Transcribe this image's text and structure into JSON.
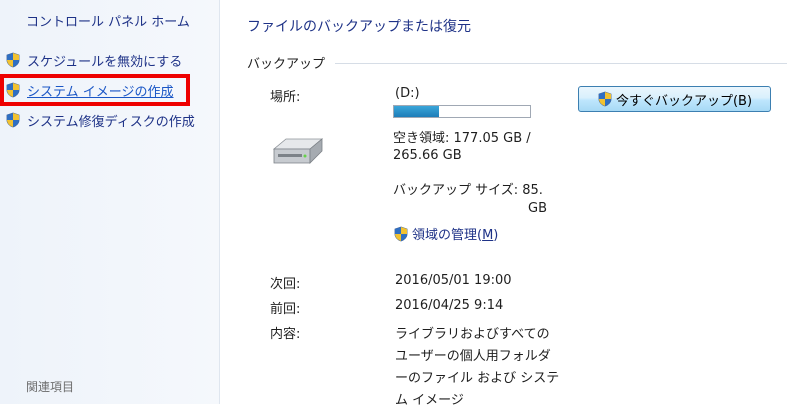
{
  "sidebar": {
    "home": "コントロール パネル ホーム",
    "items": [
      {
        "label": "スケジュールを無効にする"
      },
      {
        "label": "システム イメージの作成"
      },
      {
        "label": "システム修復ディスクの作成"
      }
    ],
    "related": "関連項目"
  },
  "main": {
    "title": "ファイルのバックアップまたは復元",
    "section_label": "バックアップ",
    "location_label": "場所:",
    "drive": "(D:)",
    "usage_fraction": 0.33,
    "free_line1": "空き領域: 177.05 GB /",
    "free_line2": "265.66 GB",
    "backup_size_line1": "バックアップ サイズ: 85.",
    "backup_size_line2": "GB",
    "manage_link": "領域の管理(",
    "manage_link_key": "M",
    "manage_link_end": ")",
    "backup_now_button": "今すぐバックアップ(B)",
    "next_label": "次回:",
    "next_value": "2016/05/01 19:00",
    "last_label": "前回:",
    "last_value": "2016/04/25 9:14",
    "contents_label": "内容:",
    "contents_lines": [
      "ライブラリおよびすべての",
      "ユーザーの個人用フォルダ",
      "ーのファイル および システ",
      "ム イメージ"
    ]
  },
  "colors": {
    "link": "#1e3287",
    "highlight": "#ee0000",
    "progress": "#2b90c8"
  },
  "icons": [
    "shield-icon",
    "drive-icon"
  ]
}
